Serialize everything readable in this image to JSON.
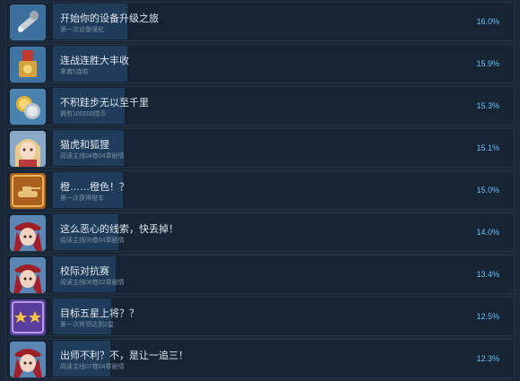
{
  "achievements": [
    {
      "title": "开始你的设备升级之旅",
      "desc": "第一次设备强化",
      "percent": "16.0%",
      "value": 16.0,
      "icon": "wrench-upgrade-icon"
    },
    {
      "title": "连战连胜大丰收",
      "desc": "拿着5连胜",
      "percent": "15.9%",
      "value": 15.9,
      "icon": "medal-icon"
    },
    {
      "title": "不积跬步无以至千里",
      "desc": "拥有100000捞币",
      "percent": "15.3%",
      "value": 15.3,
      "icon": "coins-icon"
    },
    {
      "title": "猫虎和狐狸",
      "desc": "阅读主线04卷04章剧情",
      "percent": "15.1%",
      "value": 15.1,
      "icon": "character-portrait-icon"
    },
    {
      "title": "橙……橙色！？",
      "desc": "第一次获得橙车",
      "percent": "15.0%",
      "value": 15.0,
      "icon": "tank-icon"
    },
    {
      "title": "这么恶心的线索，快丢掉！",
      "desc": "阅读主线05卷04章剧情",
      "percent": "14.0%",
      "value": 14.0,
      "icon": "officer-portrait-icon"
    },
    {
      "title": "校际对抗赛",
      "desc": "阅读主线06卷02章剧情",
      "percent": "13.4%",
      "value": 13.4,
      "icon": "officer-portrait-icon"
    },
    {
      "title": "目标五星上将？？",
      "desc": "第一次将领达到2星",
      "percent": "12.5%",
      "value": 12.5,
      "icon": "two-stars-icon"
    },
    {
      "title": "出师不利？不，是让一追三！",
      "desc": "阅读主线07卷04章剧情",
      "percent": "12.3%",
      "value": 12.3,
      "icon": "officer-portrait-icon"
    }
  ]
}
